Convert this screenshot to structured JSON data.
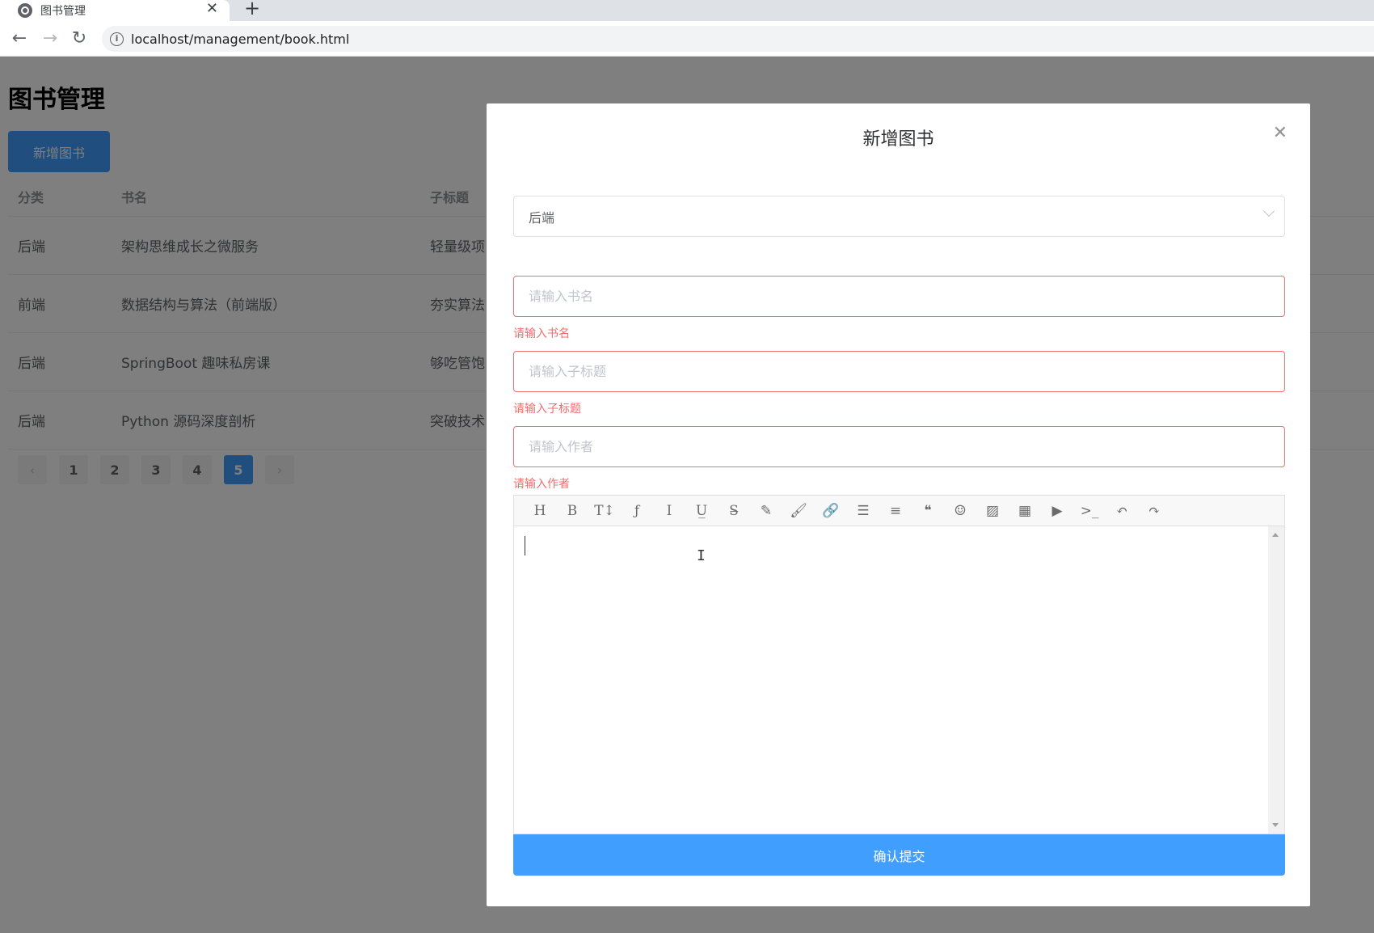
{
  "browser": {
    "tab_title": "图书管理",
    "tab_close": "✕",
    "new_tab": "+",
    "url": "localhost/management/book.html",
    "back": "←",
    "forward": "→",
    "reload": "↻",
    "info": "i"
  },
  "page": {
    "title": "图书管理",
    "add_button": "新增图书",
    "columns": [
      "分类",
      "书名",
      "子标题"
    ],
    "rows": [
      [
        "后端",
        "架构思维成长之微服务",
        "轻量级项"
      ],
      [
        "前端",
        "数据结构与算法（前端版）",
        "夯实算法"
      ],
      [
        "后端",
        "SpringBoot 趣味私房课",
        "够吃管饱"
      ],
      [
        "后端",
        "Python 源码深度剖析",
        "突破技术"
      ]
    ],
    "pagination": {
      "prev": "‹",
      "pages": [
        "1",
        "2",
        "3",
        "4",
        "5"
      ],
      "current": "5",
      "next": "›"
    }
  },
  "dialog": {
    "title": "新增图书",
    "close": "✕",
    "category_value": "后端",
    "name_placeholder": "请输入书名",
    "name_error": "请输入书名",
    "subtitle_placeholder": "请输入子标题",
    "subtitle_error": "请输入子标题",
    "author_placeholder": "请输入作者",
    "author_error": "请输入作者",
    "editor_toolbar": [
      {
        "icon": "heading-icon",
        "glyph": "H"
      },
      {
        "icon": "bold-icon",
        "glyph": "B"
      },
      {
        "icon": "font-size-icon",
        "glyph": "T↕"
      },
      {
        "icon": "font-family-icon",
        "glyph": "ƒ"
      },
      {
        "icon": "italic-icon",
        "glyph": "I"
      },
      {
        "icon": "underline-icon",
        "glyph": "U̲"
      },
      {
        "icon": "strikethrough-icon",
        "glyph": "S̶"
      },
      {
        "icon": "text-color-icon",
        "glyph": "✎"
      },
      {
        "icon": "background-color-icon",
        "glyph": "🖌"
      },
      {
        "icon": "link-icon",
        "glyph": "🔗"
      },
      {
        "icon": "list-icon",
        "glyph": "☰"
      },
      {
        "icon": "align-icon",
        "glyph": "≡"
      },
      {
        "icon": "quote-icon",
        "glyph": "❝"
      },
      {
        "icon": "emoticon-icon",
        "glyph": "☺"
      },
      {
        "icon": "image-icon",
        "glyph": "▨"
      },
      {
        "icon": "table-icon",
        "glyph": "▦"
      },
      {
        "icon": "video-icon",
        "glyph": "▶"
      },
      {
        "icon": "code-icon",
        "glyph": ">_"
      },
      {
        "icon": "undo-icon",
        "glyph": "↶"
      },
      {
        "icon": "redo-icon",
        "glyph": "↷"
      }
    ],
    "submit": "确认提交"
  }
}
